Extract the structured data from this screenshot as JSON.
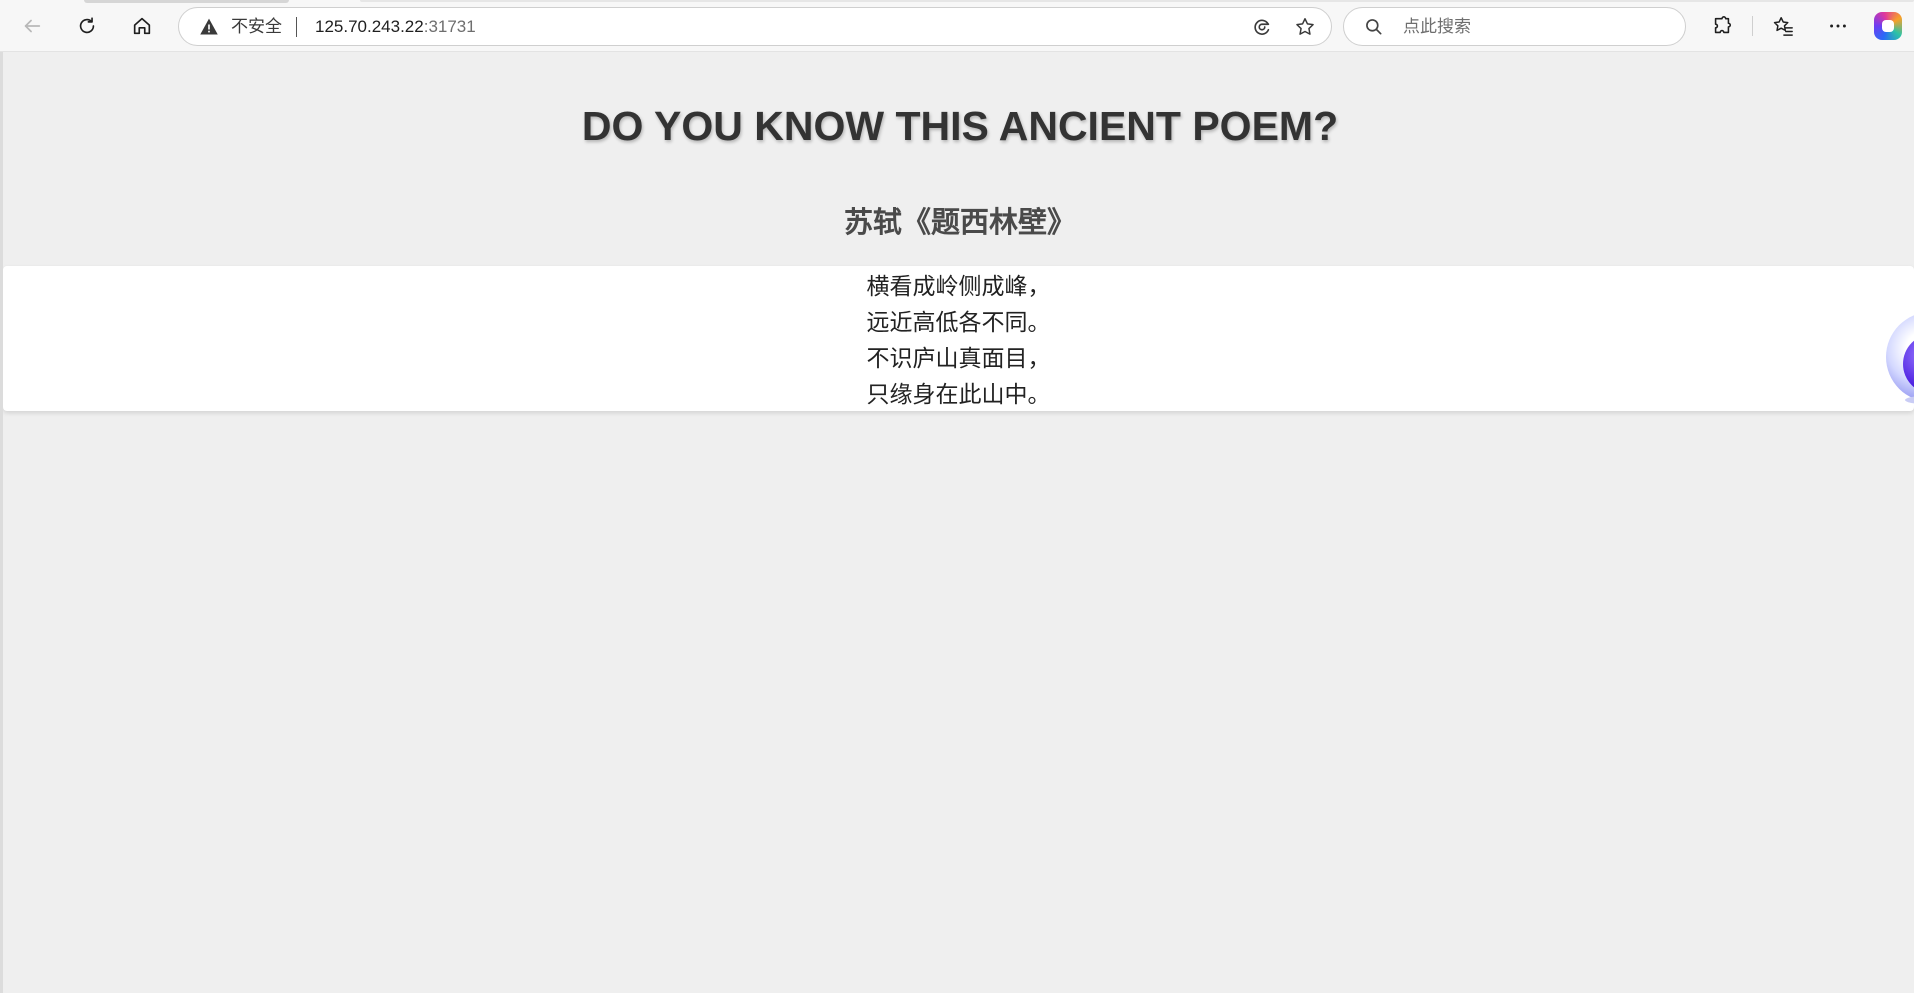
{
  "browser": {
    "insecure_label": "不安全",
    "url_host": "125.70.243.22",
    "url_port": ":31731",
    "search_placeholder": "点此搜索",
    "icons": {
      "back": "back-arrow-icon",
      "reload": "reload-icon",
      "home": "home-icon",
      "warning": "warning-icon",
      "read_aloud": "read-aloud-icon",
      "favorite": "star-icon",
      "search": "search-icon",
      "extensions": "extensions-icon",
      "favorites": "favorites-icon",
      "more": "more-icon",
      "copilot": "copilot-icon"
    }
  },
  "page": {
    "title": "DO YOU KNOW THIS ANCIENT POEM?",
    "poem_heading": "苏轼《题西林壁》",
    "poem_lines": [
      "横看成岭侧成峰，",
      "远近高低各不同。",
      "不识庐山真面目，",
      "只缘身在此山中。"
    ]
  },
  "colors": {
    "page_background": "#efefef",
    "title_text": "#333333",
    "card_background": "#ffffff"
  }
}
